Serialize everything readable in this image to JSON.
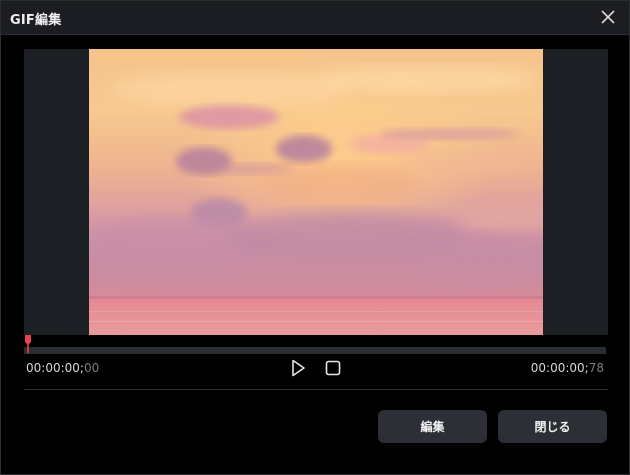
{
  "window": {
    "title": "GIF編集"
  },
  "player": {
    "current_time_main": "00:00:00;",
    "current_time_frames": "00",
    "total_time_main": "00:00:00;",
    "total_time_frames": "78",
    "progress": 0.0
  },
  "buttons": {
    "edit_label": "編集",
    "close_label": "閉じる"
  },
  "icons": {
    "close": "close-icon",
    "play": "play-icon",
    "stop": "stop-icon",
    "playhead": "playhead-marker-icon"
  },
  "colors": {
    "accent": "#e8424f",
    "button_bg": "#2c2f36",
    "titlebar_bg": "#1b1d22",
    "player_bg": "#1b1e22"
  }
}
